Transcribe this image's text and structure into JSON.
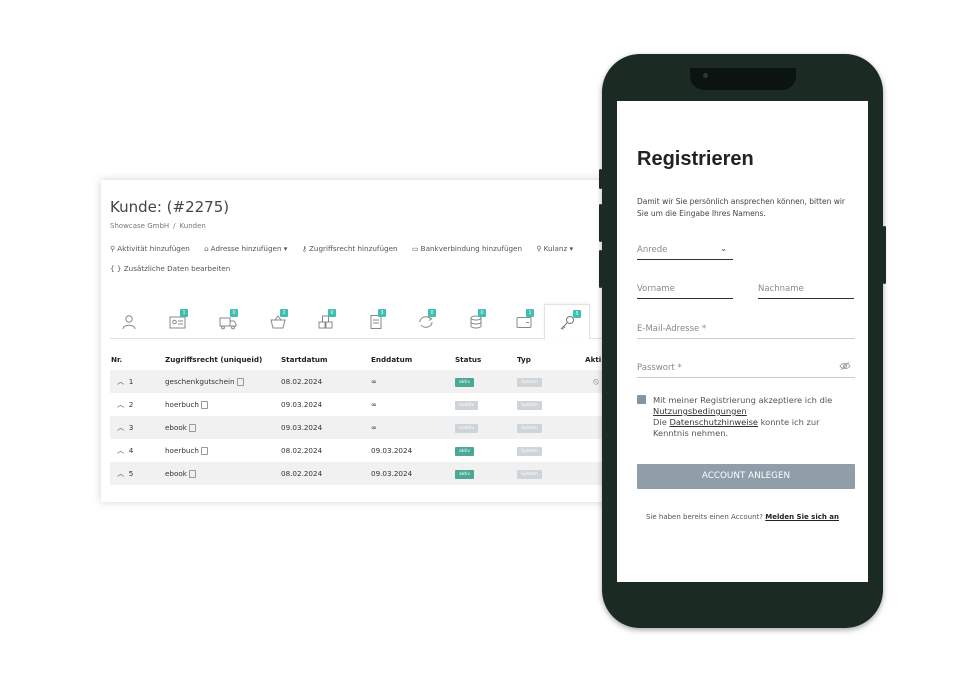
{
  "crm": {
    "title": "Kunde: (#2275)",
    "breadcrumb": [
      "Showcase GmbH",
      "Kunden"
    ],
    "breadcrumb_sep": "/",
    "actions": [
      {
        "label": "Aktivität hinzufügen",
        "icon": "user-icon"
      },
      {
        "label": "Adresse hinzufügen ▾",
        "icon": "address-icon"
      },
      {
        "label": "Zugriffsrecht hinzufügen",
        "icon": "key-icon"
      },
      {
        "label": "Bankverbindung hinzufügen",
        "icon": "folder-icon"
      },
      {
        "label": "Kulanz ▾",
        "icon": "person-icon"
      }
    ],
    "extra_action": "{ } Zusätzliche Daten bearbeiten",
    "tabs": [
      {
        "icon": "person-icon",
        "badge": ""
      },
      {
        "icon": "id-card-icon",
        "badge": "1"
      },
      {
        "icon": "truck-icon",
        "badge": "0"
      },
      {
        "icon": "basket-icon",
        "badge": "2"
      },
      {
        "icon": "boxes-icon",
        "badge": "0"
      },
      {
        "icon": "document-icon",
        "badge": "3"
      },
      {
        "icon": "refresh-icon",
        "badge": "0"
      },
      {
        "icon": "coins-icon",
        "badge": "0"
      },
      {
        "icon": "wallet-icon",
        "badge": "1"
      },
      {
        "icon": "key-icon",
        "badge": "5"
      }
    ],
    "table": {
      "headers": [
        "Nr.",
        "Zugriffsrecht (uniqueid)",
        "Startdatum",
        "Enddatum",
        "Status",
        "Typ",
        "Akti"
      ],
      "rows": [
        {
          "nr": "1",
          "name": "geschenkgutschein",
          "start": "08.02.2024",
          "end": "∞",
          "status": "aktiv",
          "typ": "System"
        },
        {
          "nr": "2",
          "name": "hoerbuch",
          "start": "09.03.2024",
          "end": "∞",
          "status": "inaktiv",
          "typ": "System"
        },
        {
          "nr": "3",
          "name": "ebook",
          "start": "09.03.2024",
          "end": "∞",
          "status": "inaktiv",
          "typ": "System"
        },
        {
          "nr": "4",
          "name": "hoerbuch",
          "start": "08.02.2024",
          "end": "09.03.2024",
          "status": "aktiv",
          "typ": "System"
        },
        {
          "nr": "5",
          "name": "ebook",
          "start": "08.02.2024",
          "end": "09.03.2024",
          "status": "aktiv",
          "typ": "System"
        }
      ]
    }
  },
  "phone": {
    "title": "Registrieren",
    "intro": "Damit wir Sie persönlich ansprechen können, bitten wir Sie um die Eingabe Ihres Namens.",
    "salutation_placeholder": "Anrede",
    "firstname_placeholder": "Vorname",
    "lastname_placeholder": "Nachname",
    "email_placeholder": "E-Mail-Adresse *",
    "password_placeholder": "Passwort *",
    "terms_text_1": "Mit meiner Registrierung akzeptiere ich die",
    "terms_link": "Nutzungsbedingungen",
    "terms_text_2": "Die",
    "privacy_link": "Datenschutzhinweise",
    "terms_text_3": "konnte ich zur Kenntnis nehmen.",
    "submit_label": "ACCOUNT ANLEGEN",
    "login_prompt": "Sie haben bereits einen Account?",
    "login_link": "Melden Sie sich an"
  },
  "colors": {
    "teal_badge": "#3fbfb0",
    "status_active": "#4aa895",
    "phone_frame": "#1b2a22",
    "submit_button": "#8f9ea9",
    "checkbox": "#8096a5"
  }
}
